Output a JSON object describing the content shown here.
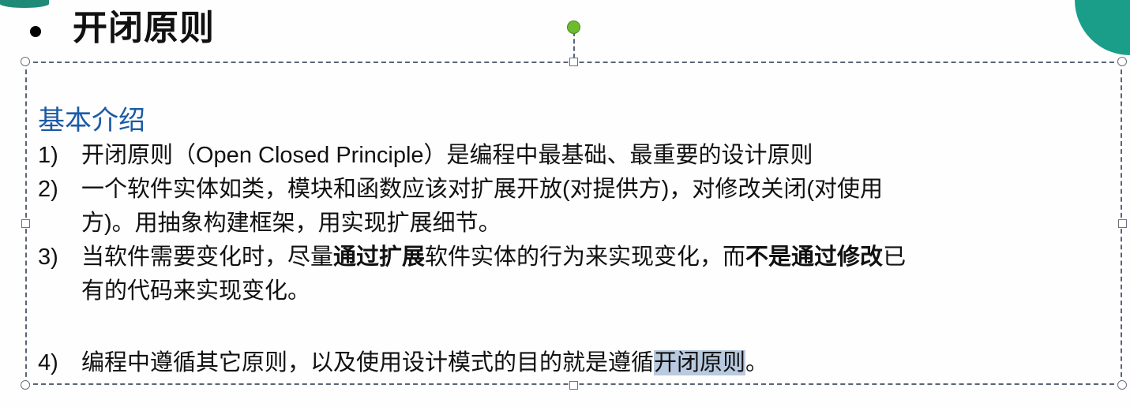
{
  "slide": {
    "title": "开闭原则",
    "section_heading": "基本介绍",
    "items": [
      {
        "num": "1)",
        "lines": [
          [
            {
              "t": "开闭原则（Open Closed Principle）是编程中最基础、最重要的设计原则"
            }
          ]
        ]
      },
      {
        "num": "2)",
        "lines": [
          [
            {
              "t": "一个软件实体如类，模块和函数应该对扩展开放(对提供方)，对修改关闭(对使用"
            }
          ],
          [
            {
              "t": "方)。用抽象构建框架，用实现扩展细节。"
            }
          ]
        ]
      },
      {
        "num": "3)",
        "lines": [
          [
            {
              "t": "当软件需要变化时，尽量"
            },
            {
              "t": "通过扩展",
              "bold": true
            },
            {
              "t": "软件实体的行为来实现变化，而"
            },
            {
              "t": "不是通过修改",
              "bold": true
            },
            {
              "t": "已"
            }
          ],
          [
            {
              "t": "有的代码来实现变化。"
            }
          ]
        ]
      },
      {
        "num": "4)",
        "lines": [
          [
            {
              "t": "编程中遵循其它原则，以及使用设计模式的目的就是遵循"
            },
            {
              "t": "开闭原则",
              "highlight": true
            },
            {
              "t": "。"
            }
          ]
        ]
      }
    ]
  },
  "colors": {
    "heading": "#1b5aa6",
    "rotate_handle": "#6dbb2e",
    "accent": "#1a9e8a",
    "selection": "#b9c9df"
  }
}
